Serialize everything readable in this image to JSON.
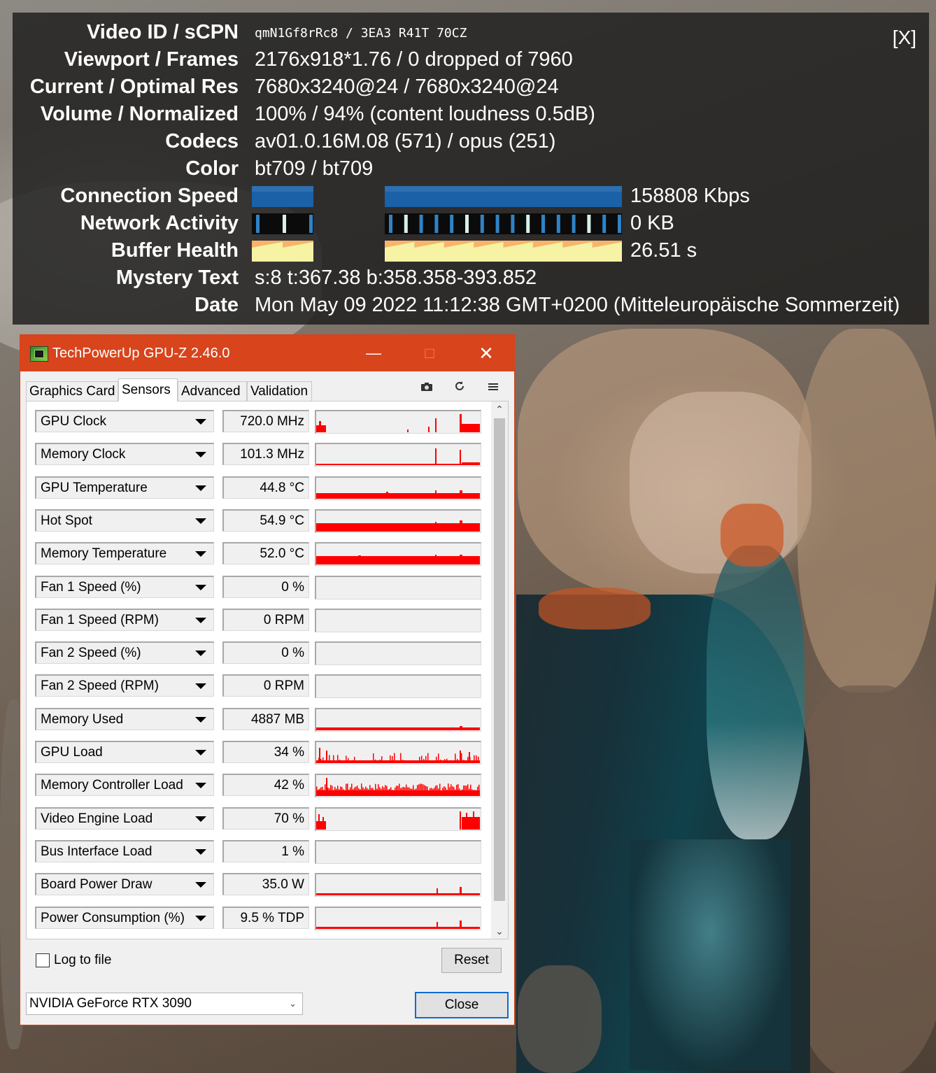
{
  "stats_overlay": {
    "close_label": "[X]",
    "rows": [
      {
        "label": "Video ID / sCPN",
        "value": "qmN1Gf8rRc8 / 3EA3 R41T 70CZ"
      },
      {
        "label": "Viewport / Frames",
        "value": "2176x918*1.76 / 0 dropped of 7960"
      },
      {
        "label": "Current / Optimal Res",
        "value": "7680x3240@24 / 7680x3240@24"
      },
      {
        "label": "Volume / Normalized",
        "value": "100% / 94% (content loudness 0.5dB)"
      },
      {
        "label": "Codecs",
        "value": "av01.0.16M.08 (571) / opus (251)"
      },
      {
        "label": "Color",
        "value": "bt709 / bt709"
      }
    ],
    "graphs": [
      {
        "label": "Connection Speed",
        "value": "158808 Kbps",
        "color": "#1a61a8"
      },
      {
        "label": "Network Activity",
        "value": "0 KB",
        "color": "#2f83c6"
      },
      {
        "label": "Buffer Health",
        "value": "26.51 s",
        "color": "#f8b46c"
      }
    ],
    "rows2": [
      {
        "label": "Mystery Text",
        "value": "s:8 t:367.38 b:358.358-393.852"
      },
      {
        "label": "Date",
        "value": "Mon May 09 2022 11:12:38 GMT+0200 (Mitteleuropäische Sommerzeit)"
      }
    ]
  },
  "gpuz": {
    "title": "TechPowerUp GPU-Z 2.46.0",
    "accent_color": "#d8441c",
    "graph_color": "#ff0000",
    "tabs": [
      "Graphics Card",
      "Sensors",
      "Advanced",
      "Validation"
    ],
    "active_tab": "Sensors",
    "toolbar_icons": [
      "camera-icon",
      "refresh-icon",
      "menu-icon"
    ],
    "sensors": [
      {
        "name": "GPU Clock",
        "value": "720.0 MHz",
        "graph": "clock"
      },
      {
        "name": "Memory Clock",
        "value": "101.3 MHz",
        "graph": "memclock"
      },
      {
        "name": "GPU Temperature",
        "value": "44.8 °C",
        "graph": "temp"
      },
      {
        "name": "Hot Spot",
        "value": "54.9 °C",
        "graph": "hotspot"
      },
      {
        "name": "Memory Temperature",
        "value": "52.0 °C",
        "graph": "memtemp"
      },
      {
        "name": "Fan 1 Speed (%)",
        "value": "0 %",
        "graph": "none"
      },
      {
        "name": "Fan 1 Speed (RPM)",
        "value": "0 RPM",
        "graph": "none"
      },
      {
        "name": "Fan 2 Speed (%)",
        "value": "0 %",
        "graph": "none"
      },
      {
        "name": "Fan 2 Speed (RPM)",
        "value": "0 RPM",
        "graph": "none"
      },
      {
        "name": "Memory Used",
        "value": "4887 MB",
        "graph": "memused"
      },
      {
        "name": "GPU Load",
        "value": "34 %",
        "graph": "gpuload"
      },
      {
        "name": "Memory Controller Load",
        "value": "42 %",
        "graph": "mcload"
      },
      {
        "name": "Video Engine Load",
        "value": "70 %",
        "graph": "veload"
      },
      {
        "name": "Bus Interface Load",
        "value": "1 %",
        "graph": "none"
      },
      {
        "name": "Board Power Draw",
        "value": "35.0 W",
        "graph": "power"
      },
      {
        "name": "Power Consumption (%)",
        "value": "9.5 % TDP",
        "graph": "power"
      }
    ],
    "log_to_file_label": "Log to file",
    "log_to_file_checked": false,
    "reset_label": "Reset",
    "gpu_selected": "NVIDIA GeForce RTX 3090",
    "close_label": "Close"
  }
}
